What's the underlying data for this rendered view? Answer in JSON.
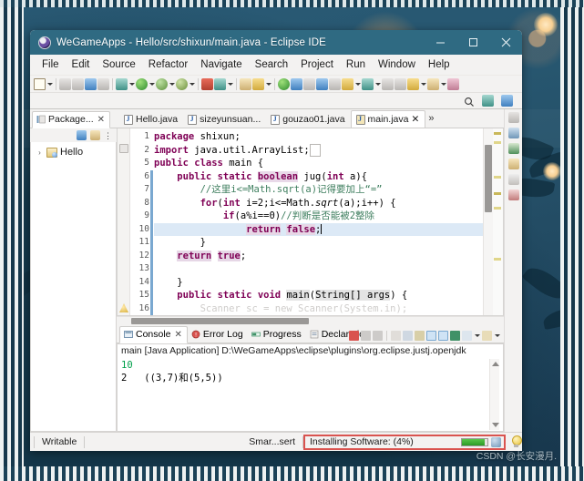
{
  "window": {
    "title": "WeGameApps - Hello/src/shixun/main.java - Eclipse IDE",
    "app_icon": "eclipse-icon",
    "controls": {
      "minimize": "minimize-icon",
      "maximize": "maximize-icon",
      "close": "close-icon"
    },
    "titlebar_color": "#2f6a82"
  },
  "menubar": {
    "items": [
      "File",
      "Edit",
      "Source",
      "Refactor",
      "Navigate",
      "Search",
      "Project",
      "Run",
      "Window",
      "Help"
    ]
  },
  "toolbar": {
    "quick_access_icon": "search-icon",
    "perspective_icons": [
      "open-perspective-icon",
      "java-perspective-icon"
    ]
  },
  "package_explorer": {
    "tab_label": "Package...",
    "tab_icon": "package-explorer-icon",
    "close_icon": "close-icon",
    "view_menu_icons": [
      "collapse-all-icon",
      "link-with-editor-icon",
      "view-menu-icon"
    ],
    "tree": [
      {
        "label": "Hello",
        "expander": "›",
        "icon": "java-project-icon"
      }
    ]
  },
  "editor": {
    "tabs": [
      {
        "label": "Hello.java",
        "active": false,
        "closable": false
      },
      {
        "label": "sizeyunsuan...",
        "active": false,
        "closable": false
      },
      {
        "label": "gouzao01.java",
        "active": false,
        "closable": false
      },
      {
        "label": "main.java",
        "active": true,
        "closable": true
      }
    ],
    "overflow_label": "»",
    "close_icon": "close-icon",
    "line_numbers": [
      "1",
      "2",
      "5",
      "6",
      "7",
      "8",
      "9",
      "10",
      "11",
      "12",
      "13",
      "14",
      "15",
      "16"
    ],
    "highlighted_line": "10",
    "code_lines": [
      "package shixun;",
      "import java.util.ArrayList;",
      "public class main {",
      "    public static boolean jug(int a){",
      "        //这里i<=Math.sqrt(a)记得要加上“=”",
      "        for(int i=2;i<=Math.sqrt(a);i++) {",
      "            if(a%i==0)//判断是否能被2整除",
      "                return false;",
      "        }",
      "        return true;",
      "",
      "    }",
      "    public static void main(String[] args) {",
      "        Scanner sc = new Scanner(System.in);"
    ],
    "keyword_color": "#7f0055",
    "comment_color": "#3f7f5f",
    "highlight_color": "#dce9f6"
  },
  "console": {
    "tabs": [
      {
        "label": "Console",
        "active": true,
        "icon": "console-icon",
        "closable": true
      },
      {
        "label": "Error Log",
        "active": false,
        "icon": "error-log-icon",
        "closable": false
      },
      {
        "label": "Progress",
        "active": false,
        "icon": "progress-icon",
        "closable": false
      },
      {
        "label": "Declaration",
        "active": false,
        "icon": "declaration-icon",
        "closable": false
      }
    ],
    "close_icon": "close-icon",
    "header": "main [Java Application] D:\\WeGameApps\\eclipse\\plugins\\org.eclipse.justj.openjdk",
    "output": [
      {
        "text": "10",
        "color": "green"
      },
      {
        "text": "2   ((3,7)和(5,5))",
        "color": "black"
      }
    ],
    "toolbar_icons": [
      "terminate-icon",
      "remove-launch-icon",
      "remove-all-icon",
      "clear-console-icon",
      "scroll-lock-icon",
      "pin-console-icon",
      "word-wrap-icon",
      "show-console-icon",
      "display-selected-icon",
      "open-console-dropdown-icon",
      "new-console-icon",
      "console-menu-icon"
    ]
  },
  "statusbar": {
    "writable": "Writable",
    "insert_mode": "Smar...sert",
    "progress_text": "Installing Software: (4%)",
    "progress_percent": 4,
    "progress_highlight_color": "#d9534f",
    "progress_fill_color": "#2c9a27",
    "cancel_icon": "cancel-operation-icon",
    "hint_icon": "lightbulb-icon"
  },
  "watermark": "CSDN @长安漫月."
}
